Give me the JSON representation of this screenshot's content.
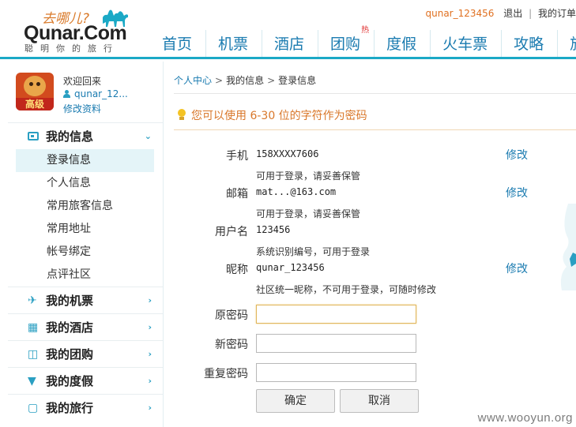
{
  "header": {
    "logo_slogan": "去哪儿?",
    "logo_text": "Qunar.Com",
    "logo_sub": "聪明你的旅行",
    "username": "qunar_123456",
    "logout": "退出",
    "orders": "我的订单"
  },
  "nav": {
    "items": [
      "首页",
      "机票",
      "酒店",
      "团购",
      "度假",
      "火车票",
      "攻略",
      "旅"
    ],
    "hot_badge": "热"
  },
  "sidebar": {
    "avatar_badge": "高级",
    "welcome": "欢迎回来",
    "username": "qunar_12...",
    "edit_profile": "修改资料",
    "my_info": "我的信息",
    "sub_items": [
      "登录信息",
      "个人信息",
      "常用旅客信息",
      "常用地址",
      "帐号绑定",
      "点评社区"
    ],
    "sections": [
      "我的机票",
      "我的酒店",
      "我的团购",
      "我的度假",
      "我的旅行"
    ]
  },
  "breadcrumb": {
    "home": "个人中心",
    "info": "我的信息",
    "current": "登录信息"
  },
  "tip": "您可以使用 6-30 位的字符作为密码",
  "fields": {
    "phone_label": "手机",
    "phone_value": "158XXXX7606",
    "phone_note": "可用于登录，请妥善保管",
    "email_label": "邮箱",
    "email_value": "mat...@163.com",
    "email_note": "可用于登录，请妥善保管",
    "username_label": "用户名",
    "username_value": "123456",
    "username_note": "系统识别编号，可用于登录",
    "nickname_label": "昵称",
    "nickname_value": "qunar_123456",
    "nickname_note": "社区统一昵称，不可用于登录，可随时修改",
    "edit": "修改"
  },
  "password": {
    "old_label": "原密码",
    "new_label": "新密码",
    "repeat_label": "重复密码",
    "old_value": "",
    "new_value": "",
    "repeat_value": ""
  },
  "buttons": {
    "confirm": "确定",
    "cancel": "取消"
  },
  "watermark": "www.wooyun.org",
  "colors": {
    "accent": "#1ba9c6",
    "link": "#1a7bb0",
    "tip": "#d9772a"
  }
}
